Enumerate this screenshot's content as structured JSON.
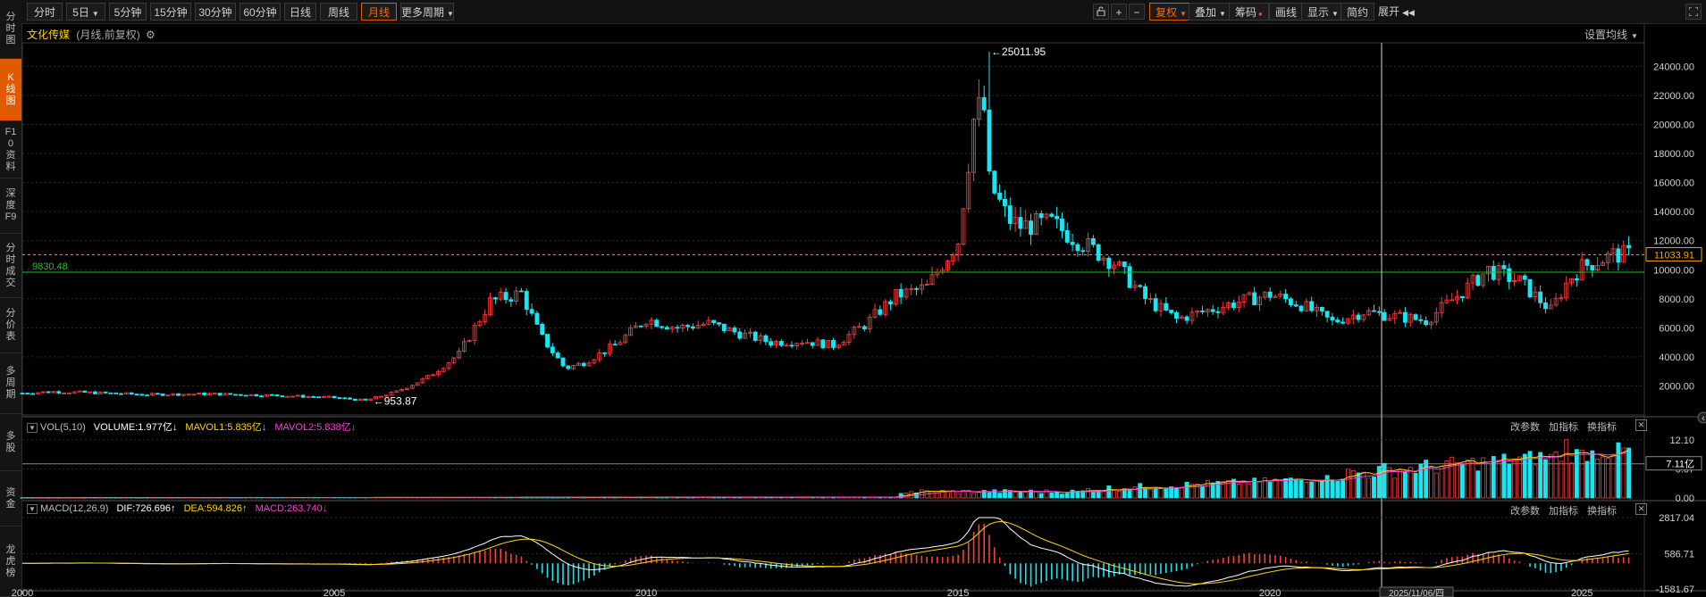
{
  "sidebar": {
    "items": [
      {
        "label": "分时图",
        "active": false
      },
      {
        "label": "K线图",
        "active": true
      },
      {
        "label": "F10资料",
        "active": false
      },
      {
        "label": "深度F9",
        "active": false
      },
      {
        "label": "分时成交",
        "active": false
      },
      {
        "label": "分价表",
        "active": false
      },
      {
        "label": "多周期",
        "active": false
      },
      {
        "label": "多股",
        "active": false
      },
      {
        "label": "资金",
        "active": false
      },
      {
        "label": "龙虎榜",
        "active": false
      }
    ]
  },
  "toolbar": {
    "periods": [
      "分时",
      "5日",
      "5分钟",
      "15分钟",
      "30分钟",
      "60分钟",
      "日线",
      "周线",
      "月线",
      "更多周期"
    ],
    "active_period": "月线",
    "lock_icon": "unlock-icon",
    "plus_icon": "plus-icon",
    "minus_icon": "minus-icon",
    "fuquan": "复权",
    "overlay": "叠加",
    "chips": "筹码",
    "draw": "画线",
    "display": "显示",
    "simple": "简约",
    "expand": "展开",
    "fullscreen_icon": "fullscreen-icon"
  },
  "header": {
    "stock_name": "文化传媒",
    "sub": "(月线,前复权)",
    "settings_icon": "gear-icon",
    "set_ma": "设置均线"
  },
  "price_panel": {
    "y_labels": [
      "24000.00",
      "22000.00",
      "20000.00",
      "18000.00",
      "16000.00",
      "14000.00",
      "12000.00",
      "10000.00",
      "8000.00",
      "6000.00",
      "4000.00",
      "2000.00"
    ],
    "current_price": "11033.91",
    "ref_line_label": "9830.48",
    "high_label": "25011.95",
    "low_label": "953.87"
  },
  "volume_panel": {
    "indicator": "VOL(5,10)",
    "volume": "VOLUME:1.977亿",
    "mavol1": "MAVOL1:5.835亿",
    "mavol2": "MAVOL2:5.838亿",
    "y_labels": [
      "12.10",
      "6.07",
      "0.00"
    ],
    "current": "7.11亿",
    "tools": [
      "改参数",
      "加指标",
      "换指标"
    ]
  },
  "macd_panel": {
    "indicator": "MACD(12,26,9)",
    "dif": "DIF:726.696",
    "dea": "DEA:594.826",
    "macd": "MACD:263.740",
    "y_labels": [
      "2817.04",
      "586.71",
      "-1581.67"
    ],
    "tools": [
      "改参数",
      "加指标",
      "换指标"
    ]
  },
  "x_axis": {
    "labels": [
      "2000",
      "2005",
      "2010",
      "2015",
      "2020",
      "2025"
    ],
    "cursor_date": "2025/11/06/四"
  },
  "colors": {
    "up": "#ff3d3d",
    "down": "#19e6f0",
    "accent": "#e25a00",
    "ref_line": "#16c816",
    "price_line": "#ffa500",
    "dea": "#ffd400",
    "macd_label": "#ff3ad6"
  },
  "chart_data": {
    "type": "candlestick",
    "title": "文化传媒",
    "y_range": [
      0,
      25500
    ],
    "x_range": [
      2000,
      2026
    ],
    "anchors": [
      [
        2000.0,
        1500
      ],
      [
        2000.5,
        1600
      ],
      [
        2001.0,
        1550
      ],
      [
        2002.0,
        1400
      ],
      [
        2003.0,
        1450
      ],
      [
        2004.0,
        1350
      ],
      [
        2005.0,
        1200
      ],
      [
        2005.5,
        1000
      ],
      [
        2006.0,
        1600
      ],
      [
        2006.5,
        2600
      ],
      [
        2007.0,
        4200
      ],
      [
        2007.5,
        7800
      ],
      [
        2008.0,
        8400
      ],
      [
        2008.3,
        5500
      ],
      [
        2008.7,
        3200
      ],
      [
        2009.0,
        3600
      ],
      [
        2009.5,
        4800
      ],
      [
        2010.0,
        6600
      ],
      [
        2010.5,
        6000
      ],
      [
        2011.0,
        6300
      ],
      [
        2011.5,
        5600
      ],
      [
        2012.0,
        5000
      ],
      [
        2012.5,
        5100
      ],
      [
        2013.0,
        4800
      ],
      [
        2013.5,
        6200
      ],
      [
        2014.0,
        8200
      ],
      [
        2014.5,
        8800
      ],
      [
        2015.0,
        12000
      ],
      [
        2015.3,
        22000
      ],
      [
        2015.5,
        16000
      ],
      [
        2015.8,
        13500
      ],
      [
        2016.0,
        13000
      ],
      [
        2016.5,
        13200
      ],
      [
        2017.0,
        11800
      ],
      [
        2017.5,
        10500
      ],
      [
        2018.0,
        8000
      ],
      [
        2018.5,
        6600
      ],
      [
        2019.0,
        7200
      ],
      [
        2019.5,
        7800
      ],
      [
        2020.0,
        8300
      ],
      [
        2020.5,
        7600
      ],
      [
        2021.0,
        6400
      ],
      [
        2021.5,
        7100
      ],
      [
        2022.0,
        6800
      ],
      [
        2022.5,
        6500
      ],
      [
        2023.0,
        8200
      ],
      [
        2023.5,
        10000
      ],
      [
        2024.0,
        9200
      ],
      [
        2024.5,
        7200
      ],
      [
        2024.8,
        9400
      ],
      [
        2025.0,
        10200
      ],
      [
        2025.5,
        11033
      ]
    ]
  }
}
